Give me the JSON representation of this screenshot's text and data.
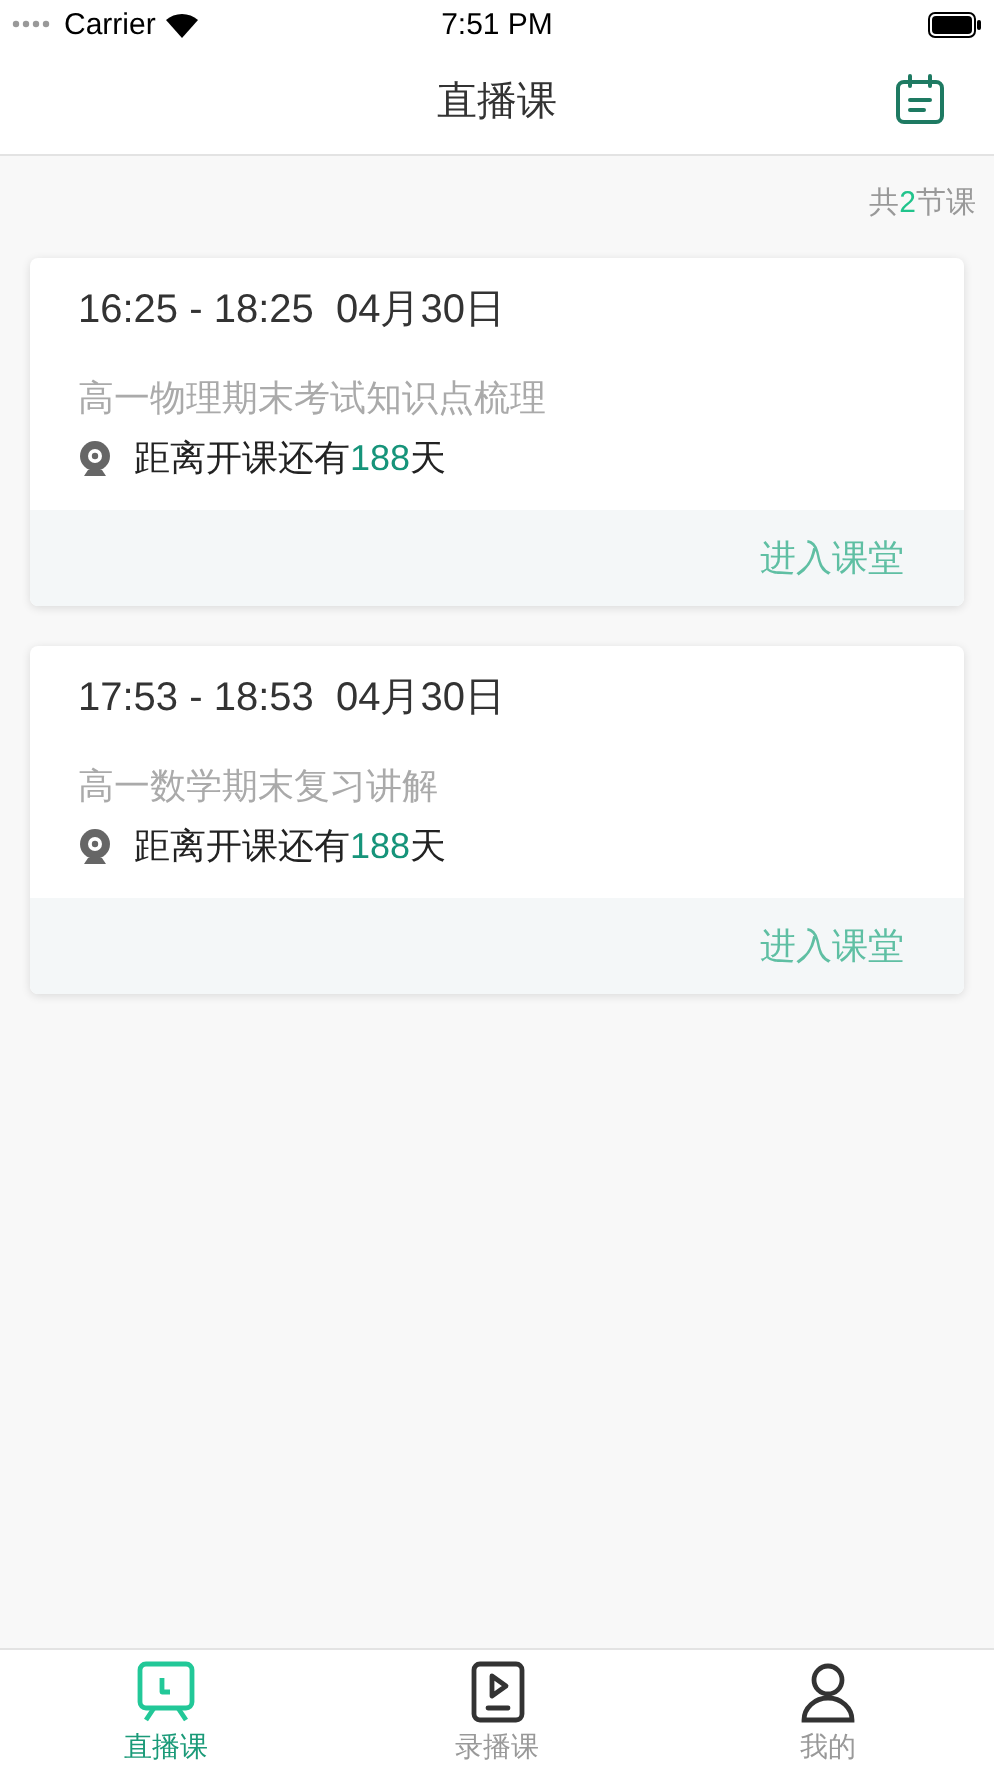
{
  "status_bar": {
    "carrier": "Carrier",
    "time": "7:51 PM"
  },
  "nav_bar": {
    "title": "直播课"
  },
  "summary": {
    "prefix": "共",
    "count": "2",
    "suffix": "节课"
  },
  "courses": [
    {
      "time": "16:25 - 18:25  04月30日",
      "title": "高一物理期末考试知识点梳理",
      "countdown_prefix": "距离开课还有",
      "days": "188",
      "countdown_suffix": "天",
      "action": "进入课堂",
      "enabled": false
    },
    {
      "time": "17:53 - 18:53  04月30日",
      "title": "高一数学期末复习讲解",
      "countdown_prefix": "距离开课还有",
      "days": "188",
      "countdown_suffix": "天",
      "action": "进入课堂",
      "enabled": false
    }
  ],
  "tab_bar": [
    {
      "label": "直播课",
      "kind": "live",
      "selected": true
    },
    {
      "label": "录播课",
      "kind": "video",
      "selected": false
    },
    {
      "label": "我的",
      "kind": "profile",
      "selected": false
    }
  ]
}
